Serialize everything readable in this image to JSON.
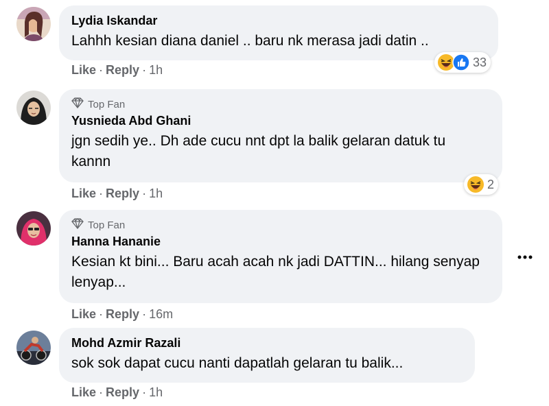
{
  "comments": [
    {
      "author": "Lydia Iskandar",
      "text": "Lahhh kesian diana daniel .. baru nk merasa jadi datin ..",
      "actions": {
        "like": "Like",
        "reply": "Reply",
        "time": "1h"
      },
      "reactions": {
        "count": "33",
        "types": [
          "haha-icon",
          "like-icon"
        ]
      }
    },
    {
      "badge": "Top Fan",
      "author": "Yusnieda Abd Ghani",
      "text": "jgn sedih ye.. Dh ade cucu nnt dpt la balik gelaran datuk tu kannn",
      "actions": {
        "like": "Like",
        "reply": "Reply",
        "time": "1h"
      },
      "reactions": {
        "count": "2",
        "types": [
          "haha-icon"
        ]
      }
    },
    {
      "badge": "Top Fan",
      "author": "Hanna Hananie",
      "text": "Kesian kt bini... Baru acah acah nk jadi DATTIN... hilang senyap lenyap...",
      "actions": {
        "like": "Like",
        "reply": "Reply",
        "time": "16m"
      }
    },
    {
      "author": "Mohd Azmir Razali",
      "text": "sok sok dapat cucu nanti dapatlah gelaran tu balik...",
      "actions": {
        "like": "Like",
        "reply": "Reply",
        "time": "1h"
      }
    }
  ],
  "colors": {
    "bubble": "#f0f2f5",
    "secondary_text": "#65676b",
    "like_blue": "#1877f2",
    "haha_yellow": "#f7b928"
  }
}
